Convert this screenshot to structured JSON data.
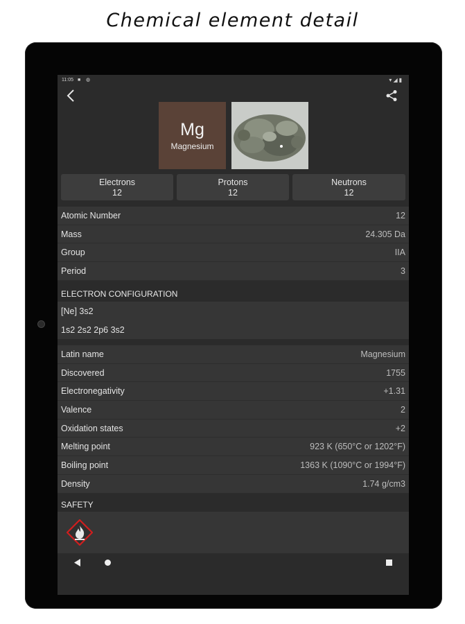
{
  "caption": "Chemical element detail",
  "statusbar": {
    "time": "11:05"
  },
  "element": {
    "symbol": "Mg",
    "name": "Magnesium",
    "tile_color": "#5a4237"
  },
  "particles": [
    {
      "label": "Electrons",
      "value": "12"
    },
    {
      "label": "Protons",
      "value": "12"
    },
    {
      "label": "Neutrons",
      "value": "12"
    }
  ],
  "basic_props": [
    {
      "label": "Atomic Number",
      "value": "12"
    },
    {
      "label": "Mass",
      "value": "24.305 Da"
    },
    {
      "label": "Group",
      "value": "IIA"
    },
    {
      "label": "Period",
      "value": "3"
    }
  ],
  "electron_configuration": {
    "header": "ELECTRON CONFIGURATION",
    "short": "[Ne] 3s2",
    "full": "1s2 2s2 2p6 3s2"
  },
  "details": [
    {
      "label": "Latin name",
      "value": "Magnesium"
    },
    {
      "label": "Discovered",
      "value": "1755"
    },
    {
      "label": "Electronegativity",
      "value": "+1.31"
    },
    {
      "label": "Valence",
      "value": "2"
    },
    {
      "label": "Oxidation states",
      "value": "+2"
    },
    {
      "label": "Melting point",
      "value": "923 K (650°C or 1202°F)"
    },
    {
      "label": "Boiling point",
      "value": "1363 K (1090°C or 1994°F)"
    },
    {
      "label": "Density",
      "value": "1.74 g/cm3"
    }
  ],
  "safety": {
    "header": "SAFETY",
    "icon": "flammable-hazard-icon",
    "icon_color": "#d01e1e"
  },
  "icons": {
    "back": "arrow-back-icon",
    "share": "share-icon"
  }
}
